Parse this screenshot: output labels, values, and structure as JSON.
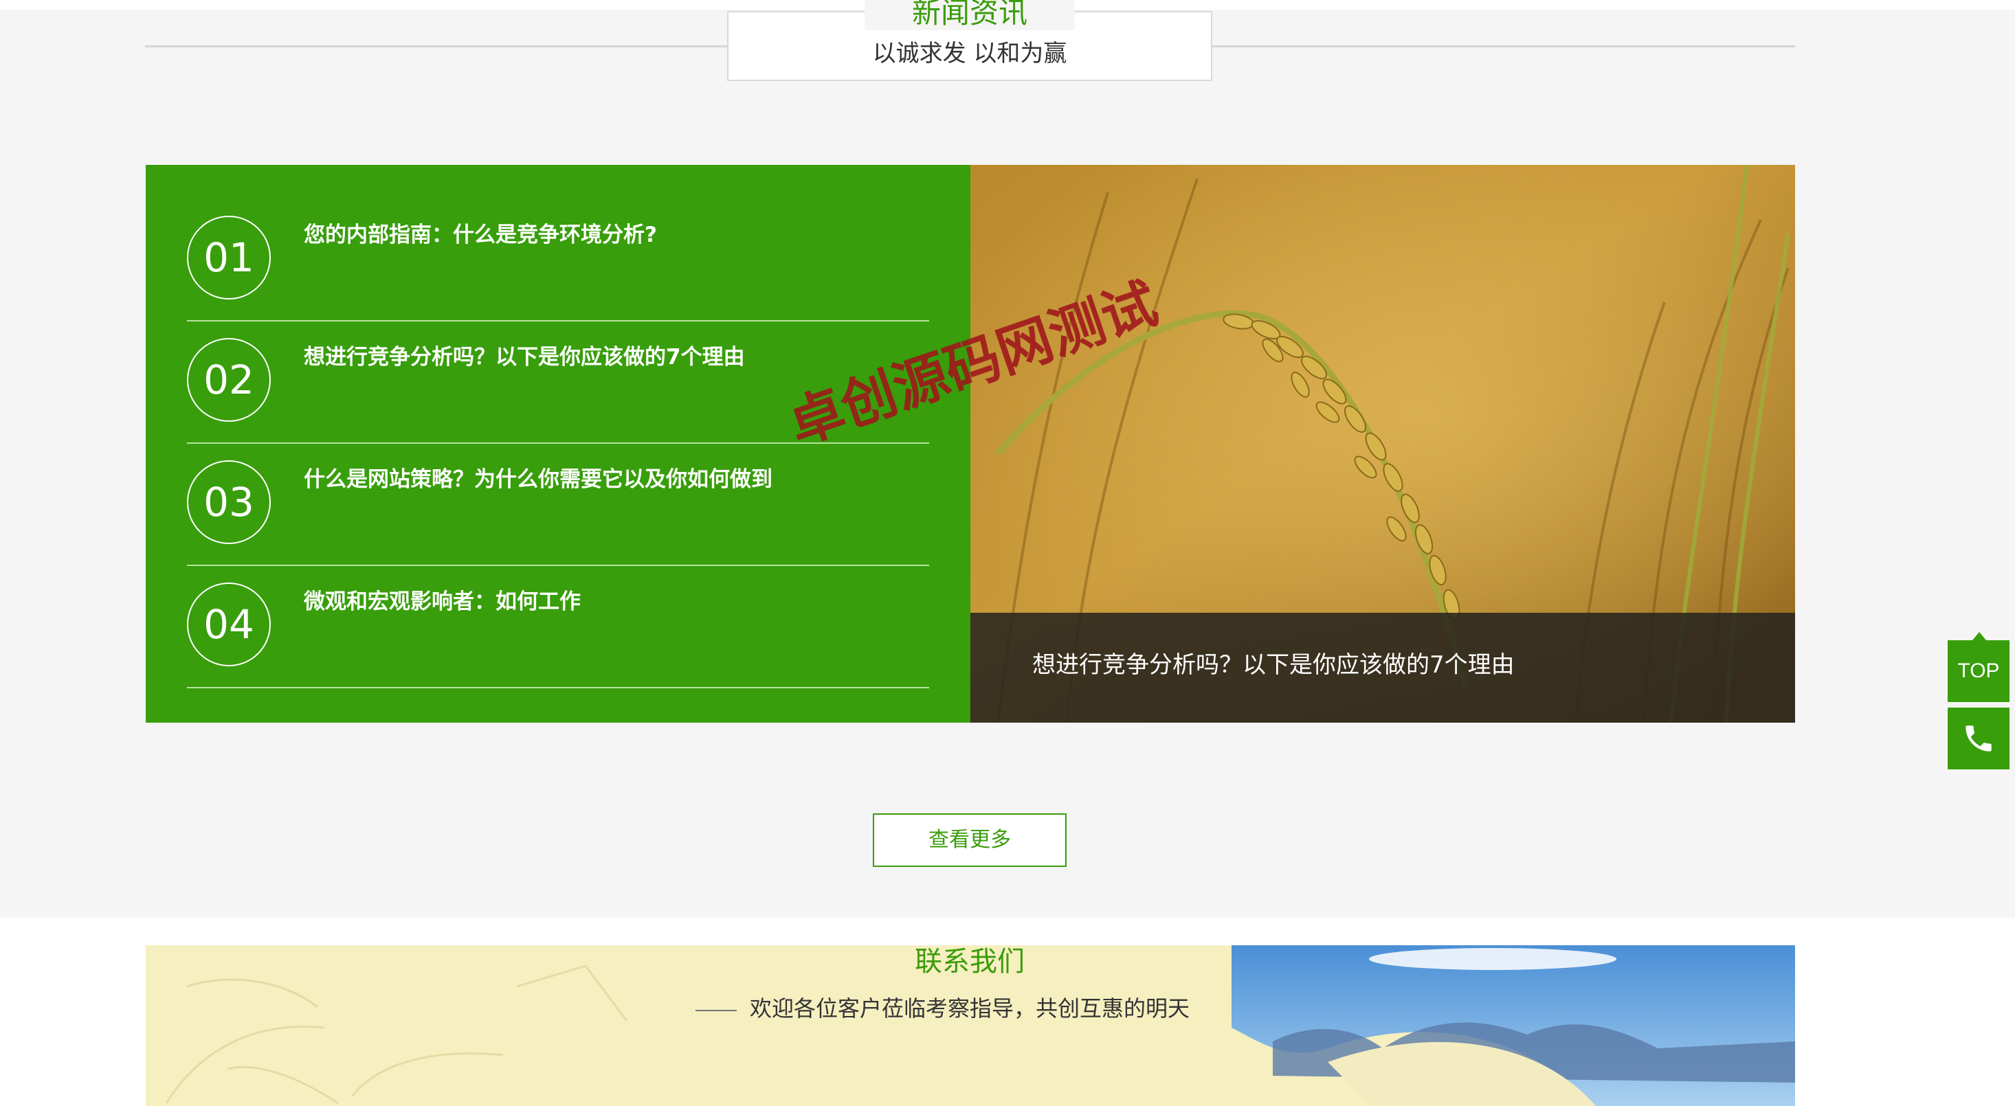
{
  "news": {
    "title": "新闻资讯",
    "subtitle": "以诚求发 以和为赢",
    "items": [
      {
        "num": "01",
        "title": "您的内部指南：什么是竞争环境分析?"
      },
      {
        "num": "02",
        "title": "想进行竞争分析吗？以下是你应该做的7个理由"
      },
      {
        "num": "03",
        "title": "什么是网站策略？为什么你需要它以及你如何做到"
      },
      {
        "num": "04",
        "title": "微观和宏观影响者：如何工作"
      }
    ],
    "featured_caption": "想进行竞争分析吗？以下是你应该做的7个理由",
    "more_label": "查看更多"
  },
  "watermark": "卓创源码网测试",
  "sidebar": {
    "top_label": "TOP",
    "phone_icon": "phone-icon"
  },
  "contact": {
    "title": "联系我们",
    "subtitle": "欢迎各位客户莅临考察指导，共创互惠的明天"
  },
  "colors": {
    "brand_green": "#389e0b",
    "caption_bg": "#28241e",
    "watermark": "#a0161c"
  }
}
